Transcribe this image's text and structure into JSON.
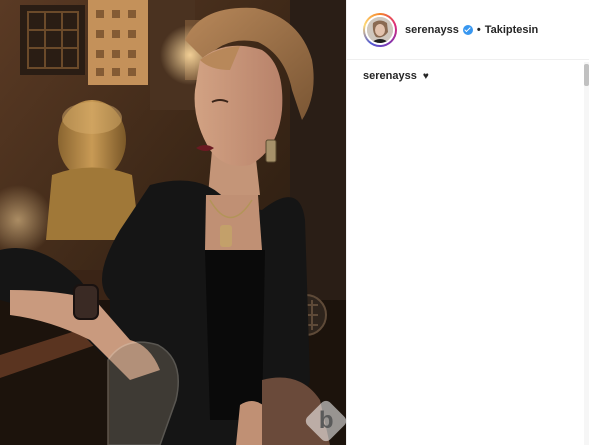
{
  "post": {
    "username": "serenayss",
    "separator": "•",
    "follow_status": "Takiptesin",
    "caption_username": "serenayss",
    "caption_text": "♥"
  },
  "watermark": {
    "letter": "b"
  },
  "colors": {
    "verified_blue": "#3897f0",
    "text": "#262626",
    "divider": "#efefef"
  },
  "icons": {
    "verified": "verified-badge-icon",
    "heart": "heart-icon"
  }
}
